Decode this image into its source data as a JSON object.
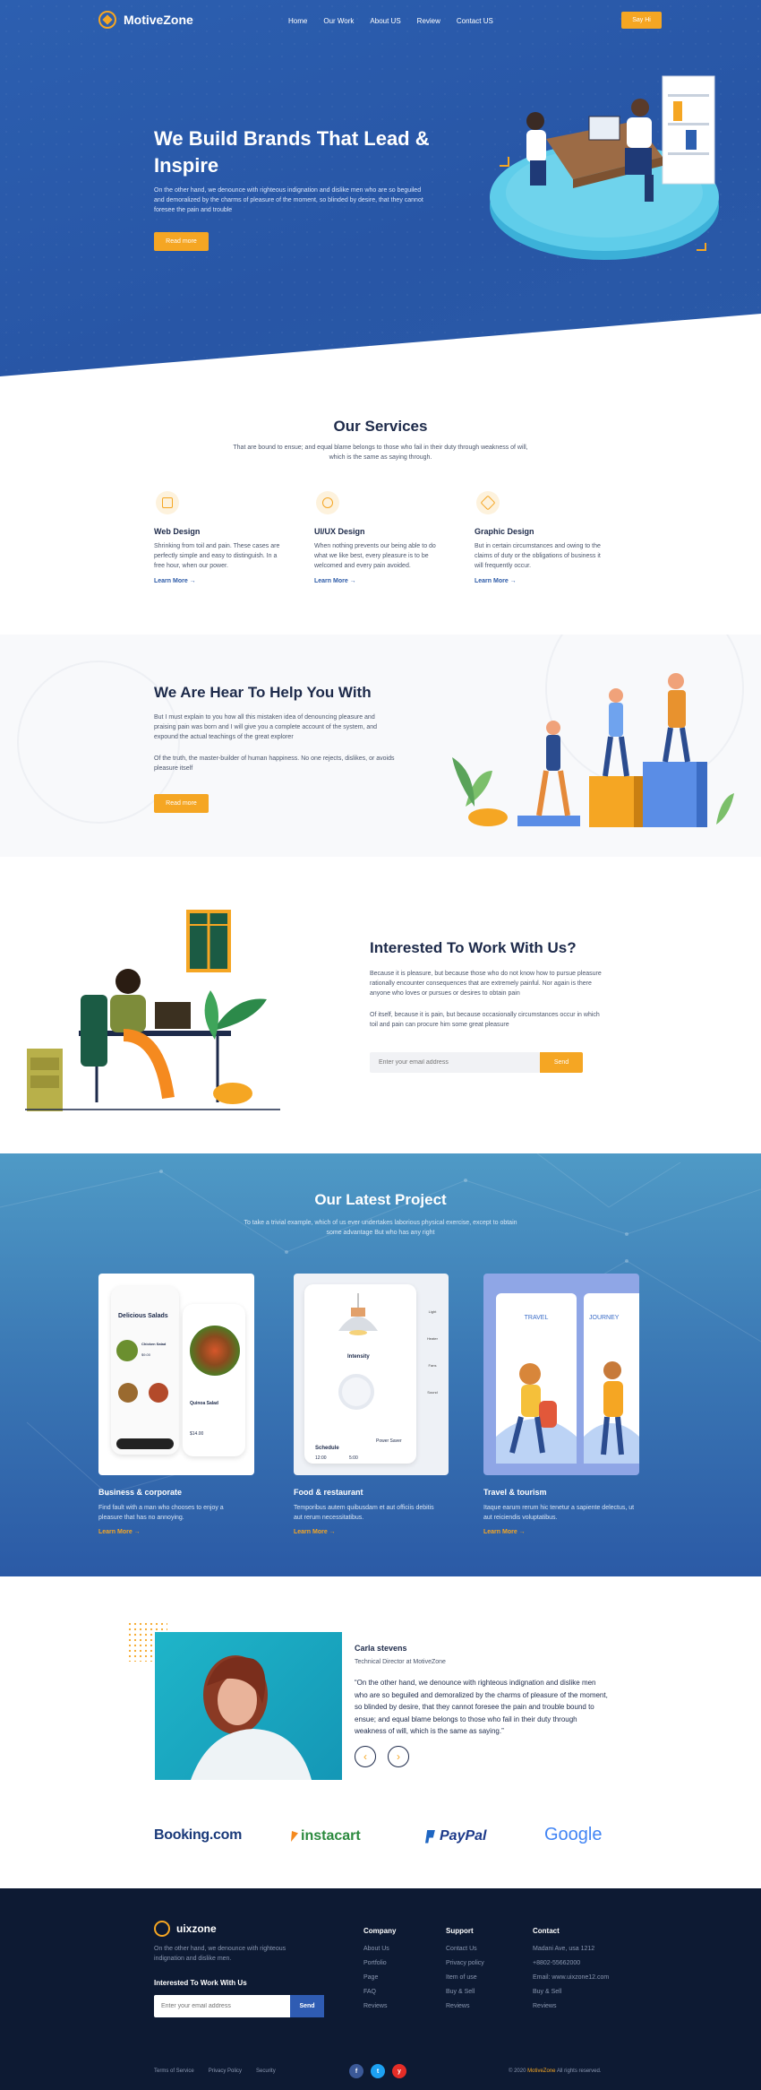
{
  "brand": {
    "name": "MotiveZone"
  },
  "nav": {
    "items": [
      "Home",
      "Our Work",
      "About US",
      "Review",
      "Contact US"
    ],
    "cta": "Say Hi"
  },
  "hero": {
    "title": "We Build Brands That Lead & Inspire",
    "text": "On the other hand, we denounce with righteous indignation and dislike men who are so beguiled and demoralized by the charms of pleasure of the moment, so blinded by desire, that they cannot foresee the pain and trouble",
    "button": "Read more"
  },
  "services": {
    "title": "Our Services",
    "subtitle": "That are bound to ensue; and equal blame belongs to those who fail in their duty through weakness of will, which is the same as saying through.",
    "items": [
      {
        "icon": "web-design-icon",
        "title": "Web Design",
        "text": "Shrinking from toil and pain. These cases are perfectly simple and easy to distinguish. In a free hour, when our power.",
        "link": "Learn More →"
      },
      {
        "icon": "uiux-design-icon",
        "title": "UI/UX Design",
        "text": "When nothing prevents our being able to do what we like best, every pleasure is to be welcomed and every pain avoided.",
        "link": "Learn More →"
      },
      {
        "icon": "graphic-design-icon",
        "title": "Graphic Design",
        "text": "But in certain circumstances and owing to the claims of duty or the obligations of business it will frequently occur.",
        "link": "Learn More →"
      }
    ]
  },
  "help": {
    "title": "We Are Hear To Help You With",
    "p1": "But I must explain to you how all this mistaken idea of denouncing pleasure and praising pain was born and I will give you a complete account of the system, and expound the actual teachings of the great explorer",
    "p2": "Of the truth, the master-builder of human happiness. No one rejects, dislikes, or avoids pleasure itself",
    "button": "Read more"
  },
  "work": {
    "title": "Interested To Work With Us?",
    "p1": "Because it is pleasure, but because those who do not know how to pursue pleasure rationally encounter consequences that are extremely painful. Nor again is there anyone who loves or pursues or desires to obtain pain",
    "p2": "Of itself, because it is pain, but because occasionally circumstances occur in which toil and pain can procure him some great pleasure",
    "email_placeholder": "Enter your email address",
    "button": "Send"
  },
  "projects": {
    "title": "Our Latest Project",
    "subtitle": "To take a trivial example, which of us ever undertakes laborious physical exercise, except to obtain some advantage But who has any right",
    "items": [
      {
        "title": "Business & corporate",
        "text": "Find fault with a man who chooses to enjoy a pleasure that has no annoying.",
        "link": "Learn More →"
      },
      {
        "title": "Food & restaurant",
        "text": "Temporibus autem quibusdam et aut officiis debitis aut rerum necessitatibus.",
        "link": "Learn More →"
      },
      {
        "title": "Travel & tourism",
        "text": "Itaque earum rerum hic tenetur a sapiente delectus, ut aut reiciendis voluptatibus.",
        "link": "Learn More →"
      }
    ],
    "mockups": {
      "salads_title": "Delicious Salads",
      "salad_name": "Chicken Salad",
      "salad_price": "$9.00",
      "quinoa": "Quinoa Salad",
      "quinoa_price": "$14.00",
      "intensity": "Intensity",
      "schedule": "Schedule",
      "power_saver": "Power Saver",
      "light": "Light",
      "heater": "Heater",
      "fans": "Fans",
      "sound": "Sound",
      "travel": "TRAVEL",
      "journey": "JOURNEY",
      "time1": "12:00",
      "time2": "5:00"
    }
  },
  "testimonial": {
    "name": "Carla stevens",
    "role": "Technical Director at MotiveZone",
    "quote": "“On the other hand, we denounce with righteous indignation and dislike men who are so beguiled and demoralized by the charms of pleasure of the moment, so blinded by desire, that they cannot foresee the pain and trouble bound to ensue; and equal blame belongs to those who fail in their duty through weakness of will, which is the same as saying.”",
    "prev": "‹",
    "next": "›"
  },
  "partners": [
    "Booking.com",
    "instacart",
    "PayPal",
    "Google"
  ],
  "footer": {
    "brand": "uixzone",
    "about": "On the other hand, we denounce with righteous indignation and dislike men.",
    "newsletter_title": "Interested To Work With Us",
    "email_placeholder": "Enter your email address",
    "send": "Send",
    "company": {
      "title": "Company",
      "items": [
        "About Us",
        "Portfolio",
        "Page",
        "FAQ",
        "Reviews"
      ]
    },
    "support": {
      "title": "Support",
      "items": [
        "Contact Us",
        "Privacy policy",
        "Item of use",
        "Buy & Sell",
        "Reviews"
      ]
    },
    "contact": {
      "title": "Contact",
      "items": [
        "Madani Ave, usa 1212",
        "+8802-55662000",
        "Email: www.uixzone12.com",
        "Buy & Sell",
        "Reviews"
      ]
    },
    "links": [
      "Terms of Service",
      "Privacy Policy",
      "Security"
    ],
    "social": [
      "f",
      "t",
      "y"
    ],
    "copyright_prefix": "© 2020",
    "copyright_brand": "MotiveZone",
    "copyright_suffix": "All rights reserved."
  },
  "colors": {
    "primary": "#2c5fb0",
    "accent": "#f5a623",
    "navy": "#1d2a4a",
    "footer": "#0d1a33"
  }
}
